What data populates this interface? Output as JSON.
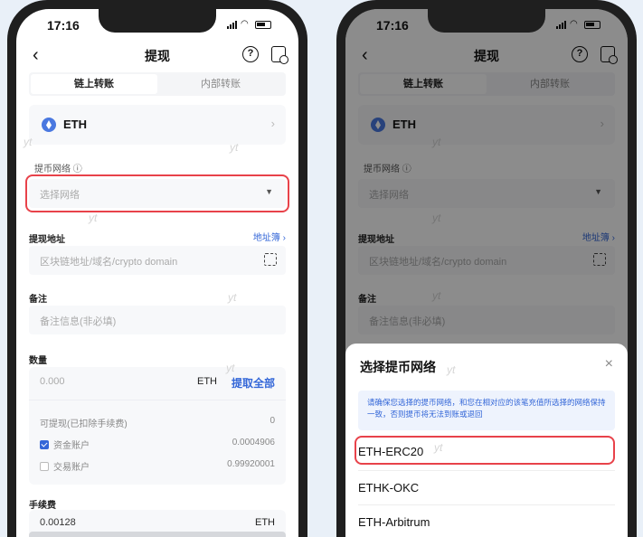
{
  "status": {
    "time": "17:16"
  },
  "nav": {
    "back": "‹",
    "title": "提现"
  },
  "tabs": {
    "onchain": "链上转账",
    "internal": "内部转账"
  },
  "coin": {
    "symbol": "ETH"
  },
  "network": {
    "label": "提币网络 ⓘ",
    "placeholder": "选择网络"
  },
  "address": {
    "label": "提现地址",
    "book_link": "地址簿 ›",
    "placeholder": "区块链地址/域名/crypto domain"
  },
  "memo": {
    "label": "备注",
    "placeholder": "备注信息(非必填)"
  },
  "amount": {
    "label": "数量",
    "placeholder": "0.000",
    "unit": "ETH",
    "withdraw_all": "提取全部",
    "available_label": "可提现(已扣除手续费)",
    "available_value": "0",
    "funding_label": "资金账户",
    "funding_value": "0.0004906",
    "trading_label": "交易账户",
    "trading_value": "0.99920001"
  },
  "fee": {
    "label": "手续费",
    "value": "0.00128",
    "unit": "ETH"
  },
  "watermark": "yt",
  "sheet": {
    "title": "选择提币网络",
    "close": "×",
    "notice": "请确保您选择的提币网络，和您在相对应的该笔充值所选择的网络保持一致，否则提币将无法到账或退回",
    "networks": [
      "ETH-ERC20",
      "ETHK-OKC",
      "ETH-Arbitrum"
    ]
  }
}
